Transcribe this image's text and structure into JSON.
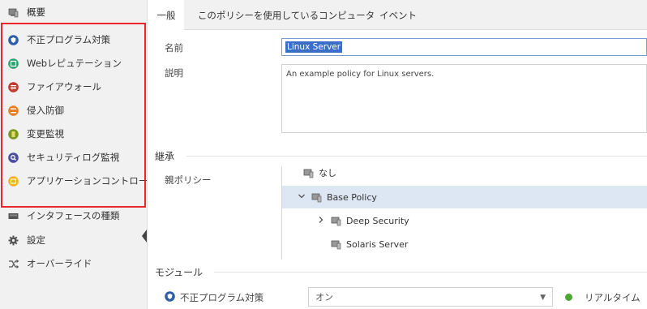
{
  "sidebar": {
    "items": [
      {
        "label": "概要",
        "icon": "computer-icon"
      },
      {
        "label": "不正プログラム対策",
        "icon": "anti-malware-icon",
        "color": "#2f5fa8"
      },
      {
        "label": "Webレピュテーション",
        "icon": "web-reputation-icon",
        "color": "#2e9e6a"
      },
      {
        "label": "ファイアウォール",
        "icon": "firewall-icon",
        "color": "#c0392b"
      },
      {
        "label": "侵入防御",
        "icon": "intrusion-prevention-icon",
        "color": "#e67e22"
      },
      {
        "label": "変更監視",
        "icon": "integrity-monitoring-icon",
        "color": "#7a9a1f"
      },
      {
        "label": "セキュリティログ監視",
        "icon": "log-inspection-icon",
        "color": "#4a4fa0"
      },
      {
        "label": "アプリケーションコントロール",
        "icon": "application-control-icon",
        "color": "#f0b323"
      },
      {
        "label": "インタフェースの種類",
        "icon": "interface-icon"
      },
      {
        "label": "設定",
        "icon": "gear-icon"
      },
      {
        "label": "オーバーライド",
        "icon": "override-icon"
      }
    ]
  },
  "tabs": [
    {
      "label": "一般"
    },
    {
      "label": "このポリシーを使用しているコンピュータ"
    },
    {
      "label": "イベント"
    }
  ],
  "general": {
    "name_label": "名前",
    "name_value": "Linux Server",
    "description_label": "説明",
    "description_value": "An example policy for Linux servers."
  },
  "inheritance": {
    "section_title": "継承",
    "parent_label": "親ポリシー",
    "tree": [
      {
        "label": "なし",
        "expander": ""
      },
      {
        "label": "Base Policy",
        "expander": "⌄"
      },
      {
        "label": "Deep Security",
        "expander": "›"
      },
      {
        "label": "Solaris Server",
        "expander": ""
      }
    ]
  },
  "modules": {
    "section_title": "モジュール",
    "row_label": "不正プログラム対策",
    "state_value": "オン",
    "status_text": "リアルタイム",
    "status_color": "#4aa832"
  },
  "colors": {
    "highlight_frame": "#e8262b",
    "selection": "#3b6ec9"
  }
}
